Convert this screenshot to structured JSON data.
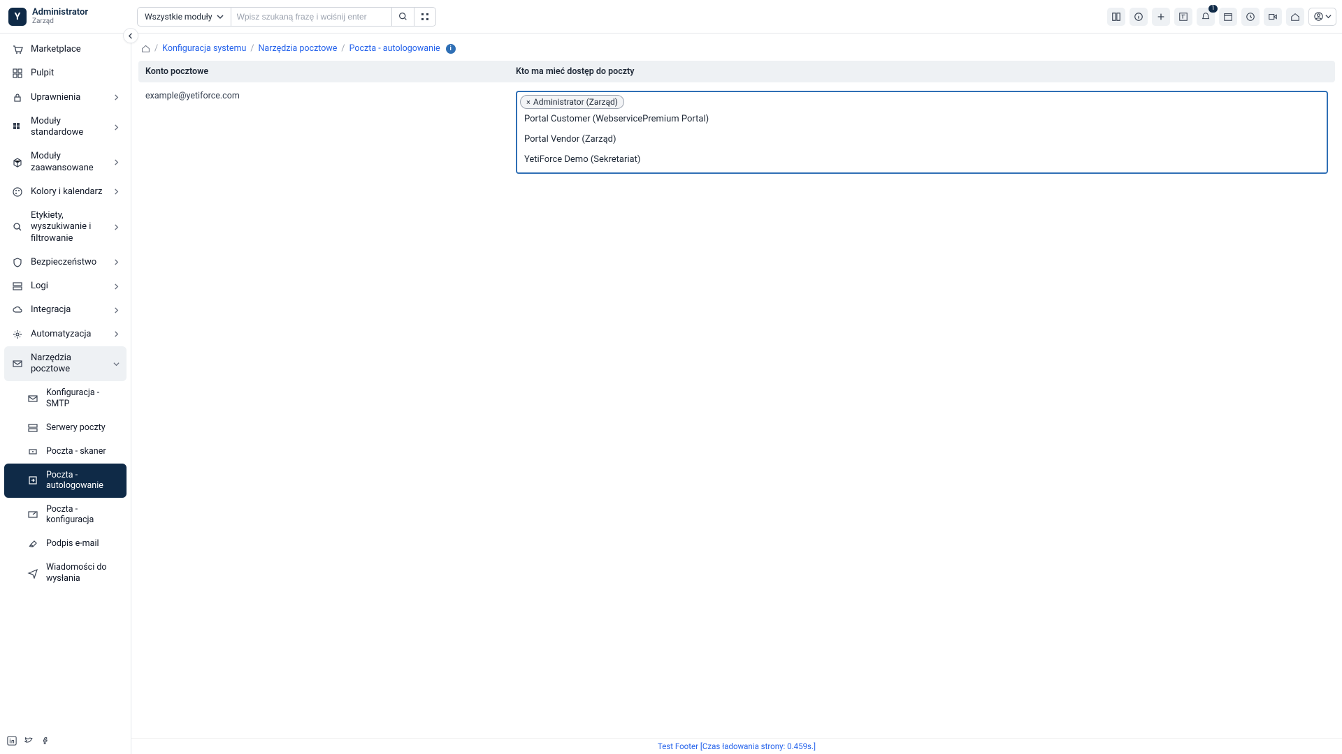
{
  "brand": {
    "admin": "Administrator",
    "role": "Zarząd",
    "logo_letter": "Y"
  },
  "header": {
    "module_select": "Wszystkie moduły",
    "search_placeholder": "Wpisz szukaną frazę i wciśnij enter",
    "notif_badge": "1"
  },
  "sidebar": {
    "items": [
      {
        "label": "Marketplace",
        "icon": "cart"
      },
      {
        "label": "Pulpit",
        "icon": "dashboard"
      },
      {
        "label": "Uprawnienia",
        "icon": "lock",
        "chev": true
      },
      {
        "label": "Moduły standardowe",
        "icon": "mods",
        "chev": true
      },
      {
        "label": "Moduły zaawansowane",
        "icon": "cube",
        "chev": true
      },
      {
        "label": "Kolory i kalendarz",
        "icon": "palette",
        "chev": true
      },
      {
        "label": "Etykiety, wyszukiwanie i filtrowanie",
        "icon": "search",
        "chev": true
      },
      {
        "label": "Bezpieczeństwo",
        "icon": "shield",
        "chev": true
      },
      {
        "label": "Logi",
        "icon": "server",
        "chev": true
      },
      {
        "label": "Integracja",
        "icon": "cloud",
        "chev": true
      },
      {
        "label": "Automatyzacja",
        "icon": "gear",
        "chev": true
      },
      {
        "label": "Narzędzia pocztowe",
        "icon": "mail",
        "chev_down": true,
        "expanded": true
      }
    ],
    "subitems": [
      {
        "label": "Konfiguracja - SMTP",
        "icon": "mailbox"
      },
      {
        "label": "Serwery poczty",
        "icon": "server"
      },
      {
        "label": "Poczta - skaner",
        "icon": "scan"
      },
      {
        "label": "Poczta - autologowanie",
        "icon": "login",
        "active": true
      },
      {
        "label": "Poczta - konfiguracja",
        "icon": "config"
      },
      {
        "label": "Podpis e-mail",
        "icon": "sign"
      },
      {
        "label": "Wiadomości do wysłania",
        "icon": "send"
      }
    ]
  },
  "breadcrumb": {
    "b1": "Konfiguracja systemu",
    "b2": "Narzędzia pocztowe",
    "b3": "Poczta - autologowanie"
  },
  "table": {
    "col_a": "Konto pocztowe",
    "col_b": "Kto ma mieć dostęp do poczty",
    "row1_account": "example@yetiforce.com",
    "selected_tag": "Administrator (Zarząd)",
    "options": [
      "Portal Customer (WebservicePremium Portal)",
      "Portal Vendor (Zarząd)",
      "YetiForce Demo (Sekretariat)"
    ]
  },
  "footer": "Test Footer [Czas ładowania strony: 0.459s.]"
}
